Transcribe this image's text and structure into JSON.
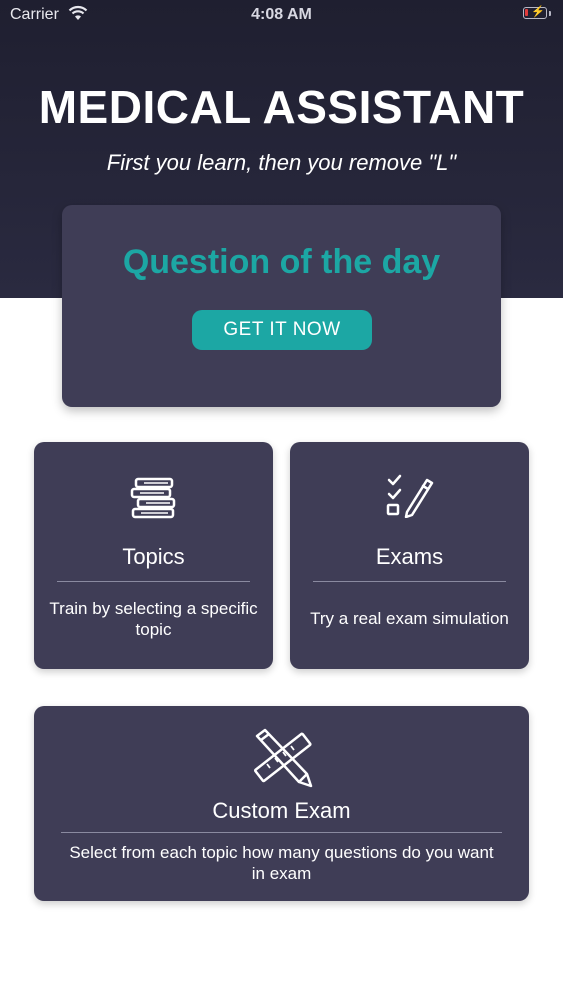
{
  "status_bar": {
    "carrier": "Carrier",
    "time": "4:08 AM"
  },
  "header": {
    "title": "MEDICAL ASSISTANT",
    "tagline": "First you learn, then you remove \"L\""
  },
  "question_of_the_day": {
    "title": "Question of the day",
    "button_label": "GET IT NOW"
  },
  "cards": {
    "topics": {
      "title": "Topics",
      "description": "Train by selecting a specific topic",
      "icon": "books-icon"
    },
    "exams": {
      "title": "Exams",
      "description": "Try a real exam simulation",
      "icon": "checklist-pencil-icon"
    },
    "custom_exam": {
      "title": "Custom Exam",
      "description": "Select from each topic how many questions do you want in exam",
      "icon": "ruler-pencil-icon"
    }
  },
  "colors": {
    "hero_bg": "#23233a",
    "card_bg": "#3f3d56",
    "accent": "#1ca7a4"
  }
}
